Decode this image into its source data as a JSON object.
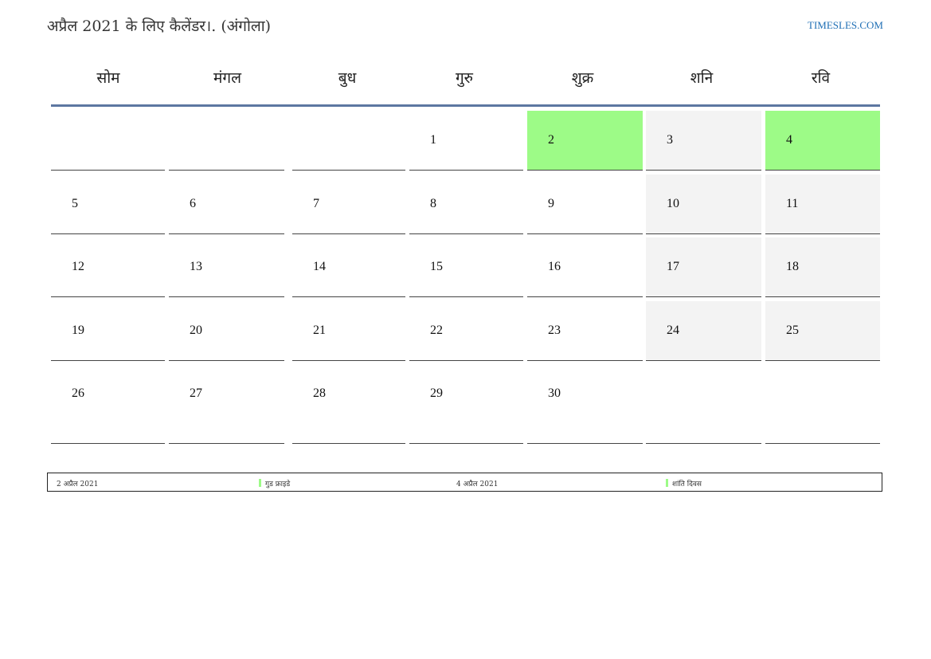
{
  "header": {
    "title": "अप्रैल 2021 के लिए कैलेंडर।. (अंगोला)",
    "site": "TIMESLES.COM"
  },
  "weekdays": [
    "सोम",
    "मंगल",
    "बुध",
    "गुरु",
    "शुक्र",
    "शनि",
    "रवि"
  ],
  "weeks": [
    [
      "",
      "",
      "",
      "1",
      "2",
      "3",
      "4"
    ],
    [
      "5",
      "6",
      "7",
      "8",
      "9",
      "10",
      "11"
    ],
    [
      "12",
      "13",
      "14",
      "15",
      "16",
      "17",
      "18"
    ],
    [
      "19",
      "20",
      "21",
      "22",
      "23",
      "24",
      "25"
    ],
    [
      "26",
      "27",
      "28",
      "29",
      "30",
      "",
      ""
    ]
  ],
  "holiday_days": [
    "2",
    "4"
  ],
  "colors": {
    "holiday": "#9dfb87",
    "weekend": "#f3f3f3",
    "rule": "#5d77a1",
    "link": "#1f6fb5"
  },
  "legend": {
    "entries": [
      {
        "date": "2 अप्रैल 2021",
        "name": "गुड फ्राइडे"
      },
      {
        "date": "4 अप्रैल 2021",
        "name": "शांति दिवस"
      }
    ]
  }
}
